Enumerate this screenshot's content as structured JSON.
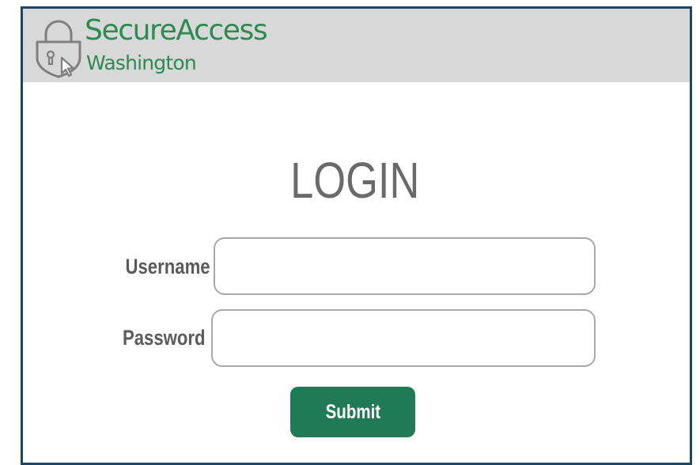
{
  "header": {
    "logo_title": "SecureAccess",
    "logo_subtitle": "Washington",
    "logo_icon": "padlock-shield-cursor-icon",
    "brand_color": "#2d8a52"
  },
  "form": {
    "title": "LOGIN",
    "username_label": "Username",
    "username_value": "",
    "password_label": "Password",
    "password_value": "",
    "submit_label": "Submit",
    "submit_color": "#1f7a55"
  },
  "colors": {
    "header_bg": "#d8d8d8",
    "border": "#1f4763",
    "label_text": "#5b5b5b",
    "title_text": "#6a6a6a"
  }
}
